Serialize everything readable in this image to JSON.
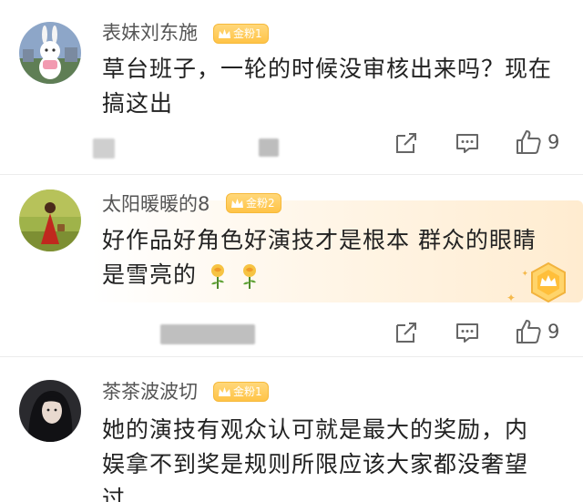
{
  "comments": [
    {
      "username": "表妹刘东施",
      "badge": "金粉1",
      "text_lines": [
        "草台班子，一轮的时候没审核出来吗？现在",
        "搞这出"
      ],
      "likes": "9",
      "avatar": "white-rabbit-avatar"
    },
    {
      "username": "太阳暖暖的8",
      "badge": "金粉2",
      "text_lines": [
        "好作品好角色好演技才是根本 群众的眼睛",
        "是雪亮的"
      ],
      "emojis": [
        "rose-emoji",
        "rose-emoji"
      ],
      "likes": "9",
      "highlighted": true,
      "avatar": "red-dress-woman-avatar"
    },
    {
      "username": "茶茶波波切",
      "badge": "金粉1",
      "text_lines": [
        "她的演技有观众认可就是最大的奖励，内",
        "娱拿不到奖是规则所限应该大家都没奢望",
        "过"
      ],
      "avatar": "dark-hair-woman-avatar"
    }
  ],
  "icons": {
    "share": "share-icon",
    "comment": "comment-icon",
    "like": "thumbs-up-icon",
    "badge": "crown-icon",
    "medal": "reward-medal-icon"
  },
  "colors": {
    "badge": "#ffc447",
    "highlight": "#fff5e6",
    "text": "#222222",
    "meta": "#555555"
  }
}
